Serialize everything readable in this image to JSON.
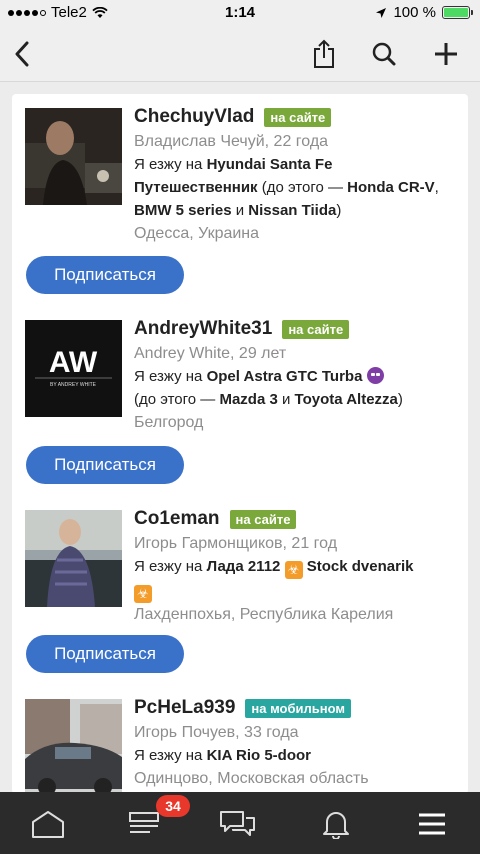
{
  "status": {
    "carrier": "Tele2",
    "time": "1:14",
    "battery": "100 %"
  },
  "colors": {
    "accent": "#3b72c9",
    "online": "#7aa83a",
    "mobile": "#2aa6a0",
    "tabbar": "#2b2b2b",
    "badge": "#e8382b"
  },
  "users": [
    {
      "username": "ChechuyVlad",
      "badge": "на сайте",
      "realname": "Владислав Чечуй, 22 года",
      "drive_prefix": "Я езжу на ",
      "car": "Hyundai Santa Fe",
      "car_line2": "Путешественник",
      "before": " (до этого — ",
      "prev1": "Honda CR-V",
      "sep1": ", ",
      "prev2": "BMW 5 series",
      "sep2": " и ",
      "prev3": "Nissan Tiida",
      "close": ")",
      "location": "Одесса, Украина",
      "follow": "Подписаться"
    },
    {
      "username": "AndreyWhite31",
      "badge": "на сайте",
      "realname": "Andrey White, 29 лет",
      "drive_prefix": "Я езжу на ",
      "car": "Opel Astra GTC Turba",
      "before": "(до этого — ",
      "prev1": "Mazda 3",
      "sep1": " и ",
      "prev2": "Toyota Altezza",
      "close": ")",
      "avatar_logo": "AW",
      "avatar_sub": "BY ANDREY WHITE",
      "location": "Белгород",
      "follow": "Подписаться"
    },
    {
      "username": "Co1eman",
      "badge": "на сайте",
      "realname": "Игорь Гармонщиков, 21 год",
      "drive_prefix": "Я езжу на ",
      "car": "Лада 2112",
      "car2": "Stock dvenarik",
      "location": "Лахденпохья, Республика Карелия",
      "follow": "Подписаться"
    },
    {
      "username": "PcHeLa939",
      "badge": "на мобильном",
      "realname": "Игорь Почуев, 33 года",
      "drive_prefix": "Я езжу на ",
      "car": "KIA Rio 5-door",
      "location": "Одинцово, Московская область"
    }
  ],
  "tabbar": {
    "notifications_count": "34"
  }
}
